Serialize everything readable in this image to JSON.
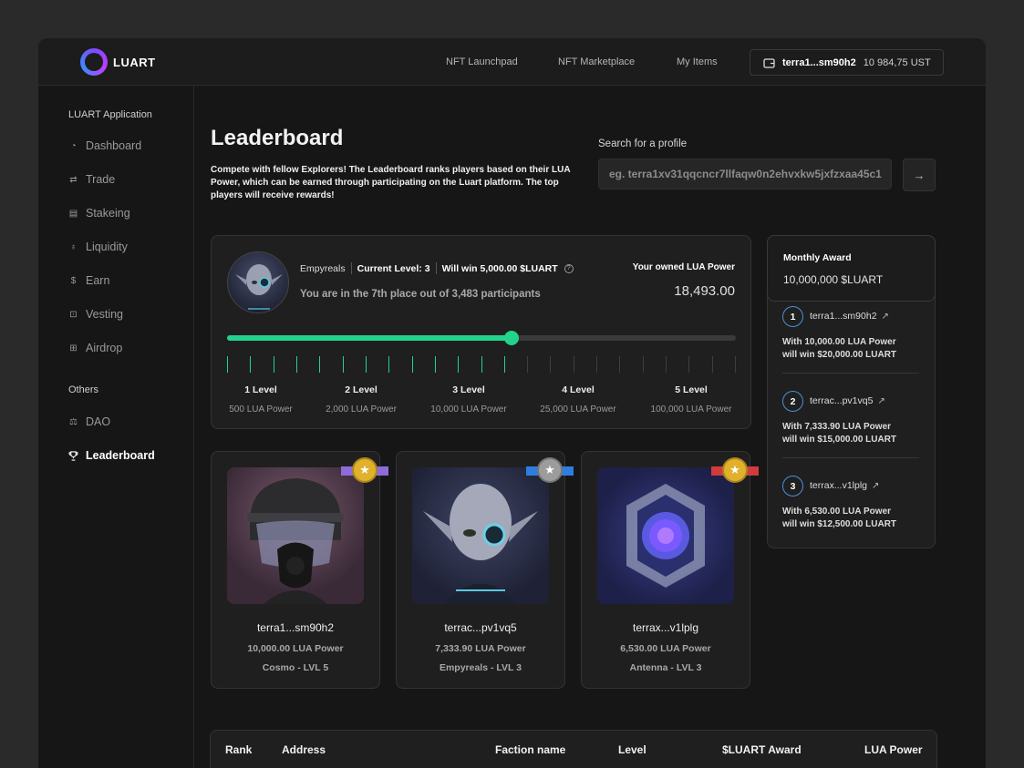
{
  "brand": {
    "name": "LUART"
  },
  "nav": {
    "launchpad": "NFT Launchpad",
    "marketplace": "NFT Marketplace",
    "my_items": "My Items"
  },
  "wallet": {
    "address": "terra1...sm90h2",
    "balance": "10 984,75 UST",
    "icon": "wallet-icon"
  },
  "sidebar": {
    "section_app": "LUART Application",
    "items": [
      {
        "label": "Dashboard",
        "icon": "gauge-icon"
      },
      {
        "label": "Trade",
        "icon": "swap-icon"
      },
      {
        "label": "Stakeing",
        "icon": "stake-icon"
      },
      {
        "label": "Liquidity",
        "icon": "flask-icon"
      },
      {
        "label": "Earn",
        "icon": "dollar-icon"
      },
      {
        "label": "Vesting",
        "icon": "vault-icon"
      },
      {
        "label": "Airdrop",
        "icon": "gift-icon"
      }
    ],
    "section_others": "Others",
    "others": [
      {
        "label": "DAO",
        "icon": "scales-icon"
      },
      {
        "label": "Leaderboard",
        "icon": "trophy-icon",
        "active": true
      }
    ]
  },
  "page": {
    "title": "Leaderboard",
    "description": "Compete with fellow Explorers! The Leaderboard ranks players based on their LUA Power, which can be earned through participating on the Luart platform. The top players will receive rewards!"
  },
  "search": {
    "label": "Search for a profile",
    "placeholder": "eg. terra1xv31qqcncr7llfaqw0n2ehvxkw5jxfzxaa45c1"
  },
  "status": {
    "faction": "Empyreals",
    "current_level": "Current Level: 3",
    "will_win": "Will win 5,000.00 $LUART",
    "place_text": "You are in the 7th place out of 3,483 participants",
    "owned_label": "Your owned LUA Power",
    "owned_value": "18,493.00",
    "progress_fraction": 0.56,
    "progress_ticks_total": 23,
    "progress_ticks_on": 13,
    "accent_color": "#22d38c",
    "levels": [
      {
        "name": "1 Level",
        "power": "500 LUA Power"
      },
      {
        "name": "2 Level",
        "power": "2,000 LUA Power"
      },
      {
        "name": "3 Level",
        "power": "10,000 LUA Power"
      },
      {
        "name": "4 Level",
        "power": "25,000 LUA Power"
      },
      {
        "name": "5 Level",
        "power": "100,000 LUA Power"
      }
    ]
  },
  "monthly_award": {
    "title": "Monthly Award",
    "amount": "10,000,000 $LUART",
    "winners": [
      {
        "rank": "1",
        "address": "terra1...sm90h2",
        "line1": "With 10,000.00 LUA Power",
        "line2": "will win $20,000.00 LUART"
      },
      {
        "rank": "2",
        "address": "terrac...pv1vq5",
        "line1": "With 7,333.90 LUA Power",
        "line2": "will win $15,000.00 LUART"
      },
      {
        "rank": "3",
        "address": "terrax...v1lplg",
        "line1": "With 6,530.00 LUA Power",
        "line2": "will win $12,500.00 LUART"
      }
    ]
  },
  "top3": [
    {
      "address": "terra1...sm90h2",
      "power": "10,000.00 LUA Power",
      "faction": "Cosmo - LVL 5",
      "medal_color": "#e1b12c",
      "ribbon_color": "#8e6bd8"
    },
    {
      "address": "terrac...pv1vq5",
      "power": "7,333.90 LUA Power",
      "faction": "Empyreals - LVL 3",
      "medal_color": "#9c9c9c",
      "ribbon_color": "#2f7de0"
    },
    {
      "address": "terrax...v1lplg",
      "power": "6,530.00 LUA Power",
      "faction": "Antenna - LVL 3",
      "medal_color": "#e1b12c",
      "ribbon_color": "#d23b3b"
    }
  ],
  "table": {
    "columns": [
      "Rank",
      "Address",
      "Faction name",
      "Level",
      "$LUART Award",
      "LUA Power"
    ]
  }
}
